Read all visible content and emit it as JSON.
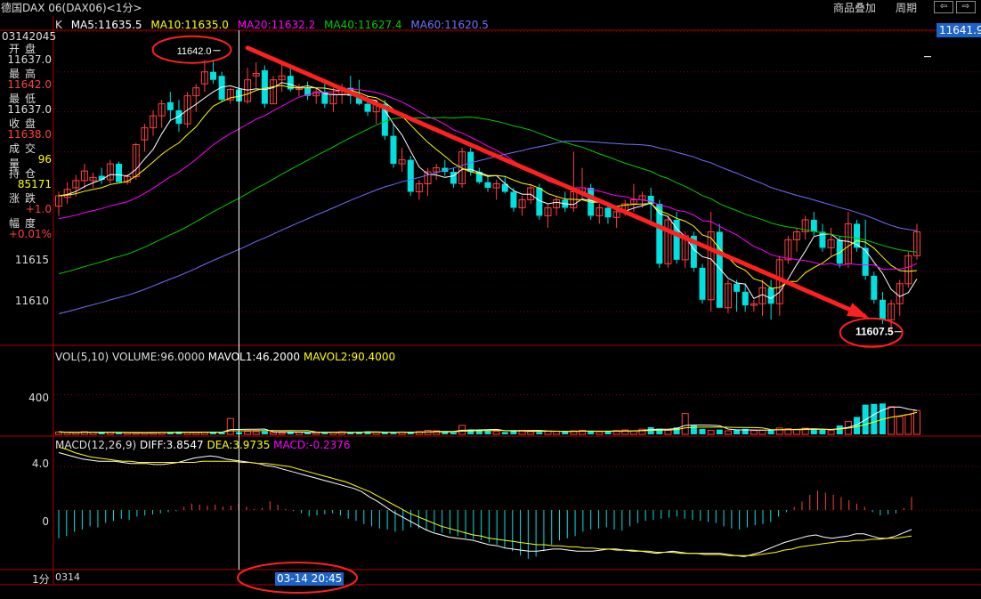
{
  "window": {
    "title": "德国DAX 06(DAX06)<1分>",
    "menu_overlay": "商品叠加",
    "menu_period": "周期",
    "nav_prev": "⇦",
    "nav_next": "⇨"
  },
  "info_panel": {
    "date": "03142045",
    "rows": [
      {
        "label": "开盘",
        "value": "11637.0",
        "color": "#dddddd"
      },
      {
        "label": "最高",
        "value": "11642.0",
        "color": "#ff4040"
      },
      {
        "label": "最低",
        "value": "11637.0",
        "color": "#dddddd"
      },
      {
        "label": "收盘",
        "value": "11638.0",
        "color": "#ff4040"
      },
      {
        "label": "成交量",
        "value": "96",
        "color": "#ffff00"
      },
      {
        "label": "持仓",
        "value": "85171",
        "color": "#ffff00"
      },
      {
        "label": "涨跌",
        "value": "+1.0",
        "color": "#ff4040"
      },
      {
        "label": "幅度",
        "value": "+0.01%",
        "color": "#ff4040"
      }
    ]
  },
  "main_legend": {
    "k": "K",
    "ma5": "MA5:11635.5",
    "ma10": "MA10:11635.0",
    "ma20": "MA20:11632.2",
    "ma40": "MA40:11627.4",
    "ma60": "MA60:11620.5"
  },
  "current_price_tag": "11641.9",
  "annotations": {
    "high_marker": "11642.0",
    "low_marker": "11607.5"
  },
  "volume_legend": {
    "title": "VOL(5,10)",
    "volume": "VOLUME:96.0000",
    "mavol1": "MAVOL1:46.2000",
    "mavol2": "MAVOL2:90.4000"
  },
  "macd_legend": {
    "title": "MACD(12,26,9)",
    "diff": "DIFF:3.8547",
    "dea": "DEA:3.9735",
    "macd": "MACD:-0.2376"
  },
  "bottom": {
    "period": "1分",
    "start_date": "0314",
    "cursor_time": "03-14 20:45"
  },
  "colors": {
    "up": "#ff4040",
    "down": "#00e0e0",
    "ma5": "#ffffff",
    "ma10": "#ffff00",
    "ma20": "#ff00ff",
    "ma40": "#00cc00",
    "ma60": "#7070ff",
    "grid": "#8b0000",
    "annotation": "#ff2020"
  },
  "chart_data": {
    "type": "candlestick",
    "price_axis_ticks": [
      11615,
      11610
    ],
    "price_ylim": [
      11605.8,
      11645.2
    ],
    "volume_axis_ticks": [
      400
    ],
    "volume_ylim": [
      0,
      720
    ],
    "macd_axis_ticks": [
      4.0,
      0
    ],
    "macd_ylim": [
      -5.5,
      6.0
    ],
    "candles": [
      [
        11623.2,
        11625.0,
        11622.0,
        11624.5
      ],
      [
        11624.3,
        11626.2,
        11623.5,
        11625.3
      ],
      [
        11625.5,
        11627.1,
        11624.4,
        11626.4
      ],
      [
        11626.4,
        11628.5,
        11625.4,
        11627.6
      ],
      [
        11626.4,
        11627.4,
        11625.5,
        11626.8
      ],
      [
        11627.0,
        11628.0,
        11626.0,
        11626.5
      ],
      [
        11626.5,
        11629.0,
        11626.0,
        11628.5
      ],
      [
        11628.5,
        11628.8,
        11626.3,
        11626.2
      ],
      [
        11626.2,
        11627.2,
        11625.9,
        11626.9
      ],
      [
        11626.9,
        11631.1,
        11626.5,
        11630.9
      ],
      [
        11631.5,
        11633.5,
        11630.0,
        11633.0
      ],
      [
        11633.0,
        11635.2,
        11632.0,
        11634.5
      ],
      [
        11634.5,
        11636.5,
        11633.0,
        11636.0
      ],
      [
        11636.2,
        11637.5,
        11634.0,
        11635.2
      ],
      [
        11635.2,
        11636.5,
        11632.5,
        11633.5
      ],
      [
        11633.5,
        11637.5,
        11633.0,
        11637.0
      ],
      [
        11637.0,
        11638.5,
        11635.0,
        11638.0
      ],
      [
        11638.5,
        11641.5,
        11637.5,
        11640.0
      ],
      [
        11640.0,
        11641.5,
        11638.5,
        11639.0
      ],
      [
        11639.5,
        11640.0,
        11636.2,
        11636.5
      ],
      [
        11636.5,
        11638.0,
        11636.0,
        11637.8
      ],
      [
        11637.8,
        11638.2,
        11636.0,
        11636.3
      ],
      [
        11636.3,
        11640.5,
        11636.0,
        11639.0
      ],
      [
        11639.5,
        11641.2,
        11638.0,
        11639.8
      ],
      [
        11640.2,
        11640.8,
        11635.5,
        11636.0
      ],
      [
        11636.0,
        11639.5,
        11636.0,
        11639.0
      ],
      [
        11639.0,
        11641.0,
        11637.5,
        11639.5
      ],
      [
        11639.5,
        11640.5,
        11637.5,
        11637.8
      ],
      [
        11637.8,
        11638.5,
        11637.0,
        11638.0
      ],
      [
        11638.0,
        11638.8,
        11636.5,
        11637.0
      ],
      [
        11637.0,
        11638.0,
        11636.0,
        11637.5
      ],
      [
        11637.5,
        11638.5,
        11635.5,
        11636.0
      ],
      [
        11636.0,
        11638.0,
        11635.0,
        11637.2
      ],
      [
        11637.2,
        11638.5,
        11636.0,
        11638.0
      ],
      [
        11638.0,
        11639.5,
        11636.0,
        11637.0
      ],
      [
        11637.0,
        11639.0,
        11635.8,
        11636.0
      ],
      [
        11636.0,
        11637.0,
        11634.5,
        11635.0
      ],
      [
        11635.0,
        11636.5,
        11633.5,
        11636.0
      ],
      [
        11636.0,
        11636.5,
        11631.5,
        11632.0
      ],
      [
        11632.0,
        11633.5,
        11628.0,
        11628.5
      ],
      [
        11628.5,
        11630.5,
        11627.5,
        11629.0
      ],
      [
        11629.0,
        11629.5,
        11624.5,
        11625.0
      ],
      [
        11625.0,
        11626.5,
        11624.0,
        11626.0
      ],
      [
        11626.0,
        11628.0,
        11624.5,
        11627.5
      ],
      [
        11627.5,
        11628.5,
        11626.5,
        11628.0
      ],
      [
        11628.0,
        11629.0,
        11627.0,
        11627.5
      ],
      [
        11627.5,
        11628.0,
        11625.5,
        11626.0
      ],
      [
        11626.0,
        11630.5,
        11625.5,
        11630.0
      ],
      [
        11630.0,
        11630.5,
        11627.0,
        11627.5
      ],
      [
        11627.5,
        11628.0,
        11626.0,
        11626.2
      ],
      [
        11626.2,
        11627.0,
        11625.0,
        11625.5
      ],
      [
        11625.5,
        11626.5,
        11624.0,
        11626.0
      ],
      [
        11626.0,
        11627.0,
        11624.8,
        11625.0
      ],
      [
        11625.0,
        11625.5,
        11622.5,
        11623.0
      ],
      [
        11623.0,
        11624.5,
        11622.0,
        11624.0
      ],
      [
        11624.0,
        11626.0,
        11623.5,
        11625.5
      ],
      [
        11625.5,
        11626.0,
        11621.5,
        11622.0
      ],
      [
        11622.0,
        11623.5,
        11620.5,
        11623.0
      ],
      [
        11623.0,
        11624.5,
        11622.0,
        11624.0
      ],
      [
        11624.0,
        11625.0,
        11622.5,
        11623.0
      ],
      [
        11623.0,
        11630.0,
        11622.5,
        11625.0
      ],
      [
        11625.0,
        11628.0,
        11624.0,
        11625.5
      ],
      [
        11625.5,
        11626.0,
        11621.5,
        11622.0
      ],
      [
        11622.0,
        11623.5,
        11621.0,
        11623.0
      ],
      [
        11623.0,
        11623.5,
        11621.0,
        11621.8
      ],
      [
        11621.8,
        11623.0,
        11620.5,
        11622.5
      ],
      [
        11622.5,
        11624.0,
        11622.0,
        11623.5
      ],
      [
        11623.5,
        11626.0,
        11622.5,
        11624.0
      ],
      [
        11624.0,
        11625.0,
        11623.0,
        11624.5
      ],
      [
        11624.5,
        11625.5,
        11621.0,
        11623.5
      ],
      [
        11623.5,
        11624.0,
        11615.5,
        11616.0
      ],
      [
        11616.0,
        11622.0,
        11615.5,
        11621.5
      ],
      [
        11621.5,
        11622.5,
        11616.0,
        11616.5
      ],
      [
        11616.5,
        11620.0,
        11615.5,
        11619.5
      ],
      [
        11619.5,
        11620.0,
        11615.0,
        11615.5
      ],
      [
        11615.5,
        11616.0,
        11611.0,
        11611.5
      ],
      [
        11611.5,
        11622.5,
        11610.0,
        11620.0
      ],
      [
        11620.0,
        11621.0,
        11611.0,
        11610.5
      ],
      [
        11610.5,
        11614.0,
        11609.8,
        11613.5
      ],
      [
        11613.5,
        11614.0,
        11610.0,
        11612.5
      ],
      [
        11612.5,
        11613.5,
        11610.0,
        11610.8
      ],
      [
        11610.8,
        11611.5,
        11610.0,
        11611.0
      ],
      [
        11611.0,
        11614.0,
        11609.5,
        11613.0
      ],
      [
        11613.0,
        11614.0,
        11609.0,
        11611.0
      ],
      [
        11611.0,
        11617.0,
        11609.5,
        11616.5
      ],
      [
        11616.5,
        11619.5,
        11616.0,
        11619.0
      ],
      [
        11619.0,
        11620.5,
        11617.5,
        11620.0
      ],
      [
        11620.0,
        11622.0,
        11619.0,
        11621.5
      ],
      [
        11621.5,
        11622.5,
        11619.5,
        11620.0
      ],
      [
        11620.0,
        11621.0,
        11617.5,
        11618.0
      ],
      [
        11618.0,
        11620.5,
        11617.0,
        11619.0
      ],
      [
        11619.0,
        11619.5,
        11615.5,
        11616.0
      ],
      [
        11616.0,
        11622.5,
        11615.5,
        11621.0
      ],
      [
        11621.0,
        11621.5,
        11617.5,
        11618.0
      ],
      [
        11618.0,
        11621.5,
        11614.0,
        11614.5
      ],
      [
        11614.5,
        11615.0,
        11611.0,
        11611.5
      ],
      [
        11611.5,
        11612.5,
        11608.5,
        11609.0
      ],
      [
        11609.0,
        11611.5,
        11607.5,
        11611.0
      ],
      [
        11611.0,
        11614.0,
        11609.5,
        11613.5
      ],
      [
        11613.5,
        11617.5,
        11613.0,
        11617.0
      ],
      [
        11617.0,
        11621.0,
        11616.5,
        11620.0
      ]
    ],
    "volumes": [
      24,
      20,
      18,
      26,
      22,
      19,
      20,
      14,
      16,
      15,
      18,
      20,
      22,
      24,
      28,
      20,
      18,
      22,
      25,
      18,
      160,
      22,
      30,
      28,
      32,
      20,
      16,
      24,
      22,
      20,
      18,
      16,
      22,
      26,
      20,
      24,
      30,
      22,
      18,
      16,
      24,
      20,
      28,
      40,
      36,
      22,
      18,
      90,
      50,
      44,
      36,
      30,
      24,
      36,
      40,
      28,
      24,
      34,
      30,
      26,
      36,
      40,
      32,
      26,
      30,
      38,
      44,
      36,
      52,
      72,
      58,
      42,
      70,
      210,
      90,
      55,
      40,
      48,
      36,
      44,
      56,
      38,
      42,
      40,
      64,
      58,
      48,
      62,
      50,
      46,
      40,
      90,
      130,
      176,
      300,
      308,
      312,
      280,
      180,
      200,
      240,
      290,
      330,
      160,
      90
    ],
    "macd_hist": [
      -2.6,
      -2.4,
      -2.0,
      -1.8,
      -1.5,
      -1.6,
      -1.2,
      -1.0,
      -0.8,
      -0.9,
      -0.6,
      -0.5,
      -0.4,
      -0.3,
      -0.2,
      -0.1,
      0.3,
      0.6,
      0.5,
      0.4,
      0.5,
      0.3,
      0.4,
      0.6,
      0.3,
      0.1,
      0.2,
      0.8,
      0.5,
      0.1,
      -0.1,
      -0.3,
      -0.6,
      -0.5,
      -0.4,
      -0.3,
      -0.5,
      -0.8,
      -1.0,
      -1.3,
      -1.5,
      -1.7,
      -1.8,
      -2.0,
      -1.9,
      -1.6,
      -1.7,
      -1.8,
      -2.0,
      -2.1,
      -2.2,
      -2.4,
      -2.6,
      -2.7,
      -2.8,
      -3.0,
      -3.2,
      -3.5,
      -3.8,
      -4.2,
      -4.5,
      -4.3,
      -3.8,
      -3.2,
      -2.8,
      -2.6,
      -2.4,
      -2.0,
      -1.8,
      -1.7,
      -1.6,
      -1.8,
      -1.9,
      -1.5,
      -1.2,
      -1.0,
      -0.9,
      -0.8,
      -0.7,
      -0.6,
      -0.8,
      -0.9,
      -1.0,
      -1.1,
      -1.2,
      -1.5,
      -1.7,
      -1.8,
      -1.6,
      -1.4,
      -1.3,
      -1.1,
      -0.6,
      -0.2,
      0.3,
      0.8,
      1.4,
      1.8,
      1.6,
      1.4,
      1.2,
      0.9,
      0.6,
      0.3,
      -0.2,
      -0.5,
      -0.4,
      -0.3,
      0.2,
      1.2
    ],
    "diff_series": [
      5.3,
      5.1,
      4.9,
      4.7,
      4.6,
      4.5,
      4.5,
      4.5,
      4.4,
      4.3,
      4.3,
      4.3,
      4.2,
      4.2,
      4.3,
      4.4,
      4.6,
      4.8,
      4.9,
      5.0,
      4.9,
      4.7,
      4.6,
      4.5,
      4.4,
      4.3,
      4.1,
      4.0,
      3.8,
      3.6,
      3.4,
      3.2,
      3.0,
      2.8,
      2.6,
      2.4,
      2.2,
      2.0,
      1.7,
      1.2,
      0.8,
      0.3,
      -0.2,
      -0.6,
      -1.0,
      -1.4,
      -1.8,
      -2.1,
      -2.3,
      -2.5,
      -2.6,
      -2.7,
      -2.8,
      -3.0,
      -3.2,
      -3.3,
      -3.5,
      -3.6,
      -3.7,
      -3.8,
      -3.8,
      -3.7,
      -3.6,
      -3.6,
      -3.7,
      -3.8,
      -3.8,
      -3.8,
      -3.7,
      -3.6,
      -3.6,
      -3.7,
      -3.8,
      -3.8,
      -3.9,
      -4.0,
      -3.9,
      -3.8,
      -3.9,
      -4.0,
      -4.0,
      -4.0,
      -4.0,
      -4.0,
      -4.1,
      -4.2,
      -4.3,
      -4.1,
      -3.9,
      -3.6,
      -3.3,
      -3.0,
      -2.8,
      -2.6,
      -2.4,
      -2.3,
      -2.5,
      -2.6,
      -2.5,
      -2.4,
      -2.2,
      -2.2,
      -2.4,
      -2.6,
      -2.6,
      -2.4,
      -2.1,
      -1.8
    ],
    "dea_series": [
      5.8,
      5.6,
      5.3,
      5.1,
      4.9,
      4.8,
      4.7,
      4.6,
      4.5,
      4.5,
      4.4,
      4.4,
      4.4,
      4.4,
      4.4,
      4.4,
      4.4,
      4.4,
      4.5,
      4.5,
      4.5,
      4.5,
      4.5,
      4.4,
      4.4,
      4.3,
      4.3,
      4.2,
      4.1,
      4.0,
      3.8,
      3.6,
      3.4,
      3.2,
      3.0,
      2.8,
      2.6,
      2.3,
      2.0,
      1.7,
      1.3,
      0.9,
      0.5,
      0.1,
      -0.3,
      -0.6,
      -0.9,
      -1.2,
      -1.5,
      -1.7,
      -1.9,
      -2.1,
      -2.3,
      -2.4,
      -2.6,
      -2.7,
      -2.8,
      -2.9,
      -3.0,
      -3.1,
      -3.2,
      -3.2,
      -3.3,
      -3.3,
      -3.4,
      -3.4,
      -3.5,
      -3.5,
      -3.6,
      -3.6,
      -3.7,
      -3.7,
      -3.7,
      -3.8,
      -3.8,
      -3.9,
      -3.9,
      -3.9,
      -4.0,
      -4.0,
      -4.0,
      -4.1,
      -4.1,
      -4.1,
      -4.2,
      -4.2,
      -4.2,
      -4.2,
      -4.1,
      -4.0,
      -3.9,
      -3.7,
      -3.6,
      -3.4,
      -3.3,
      -3.2,
      -3.1,
      -3.0,
      -2.9,
      -2.9,
      -2.8,
      -2.8,
      -2.7,
      -2.7,
      -2.6,
      -2.6,
      -2.5,
      -2.4
    ]
  }
}
